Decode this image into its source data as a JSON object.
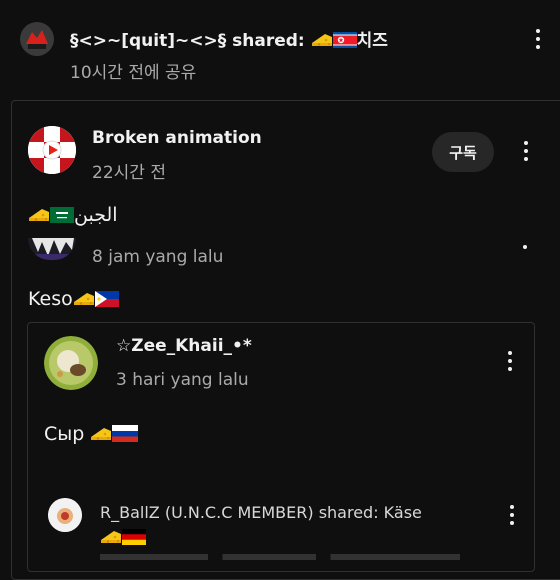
{
  "post1": {
    "title": "§<>~[quit]~<>§ shared:",
    "title_suffix": "치즈",
    "time": "10시간 전에 공유"
  },
  "card1": {
    "channel": "Broken animation",
    "time": "22시간 전",
    "subscribe_label": "구독",
    "body_text": "الجبن"
  },
  "reply1": {
    "time": "8 jam yang lalu",
    "body_text": "Keso"
  },
  "card2": {
    "channel": "☆Zee_Khaii_•*",
    "time": "3 hari yang lalu",
    "body_text": "Сыр"
  },
  "card3": {
    "title": "R_BallZ (U.N.C.C MEMBER) shared: Käse"
  },
  "colors": {
    "background": "#0f0f0f",
    "secondary_text": "#aaaaaa",
    "subscribe_bg": "#272727",
    "border": "#303030"
  },
  "icons": [
    "cheese-icon",
    "north-korea-flag-icon",
    "saudi-flag-icon",
    "philippines-flag-icon",
    "russia-flag-icon",
    "germany-flag-icon",
    "more-options-icon"
  ]
}
